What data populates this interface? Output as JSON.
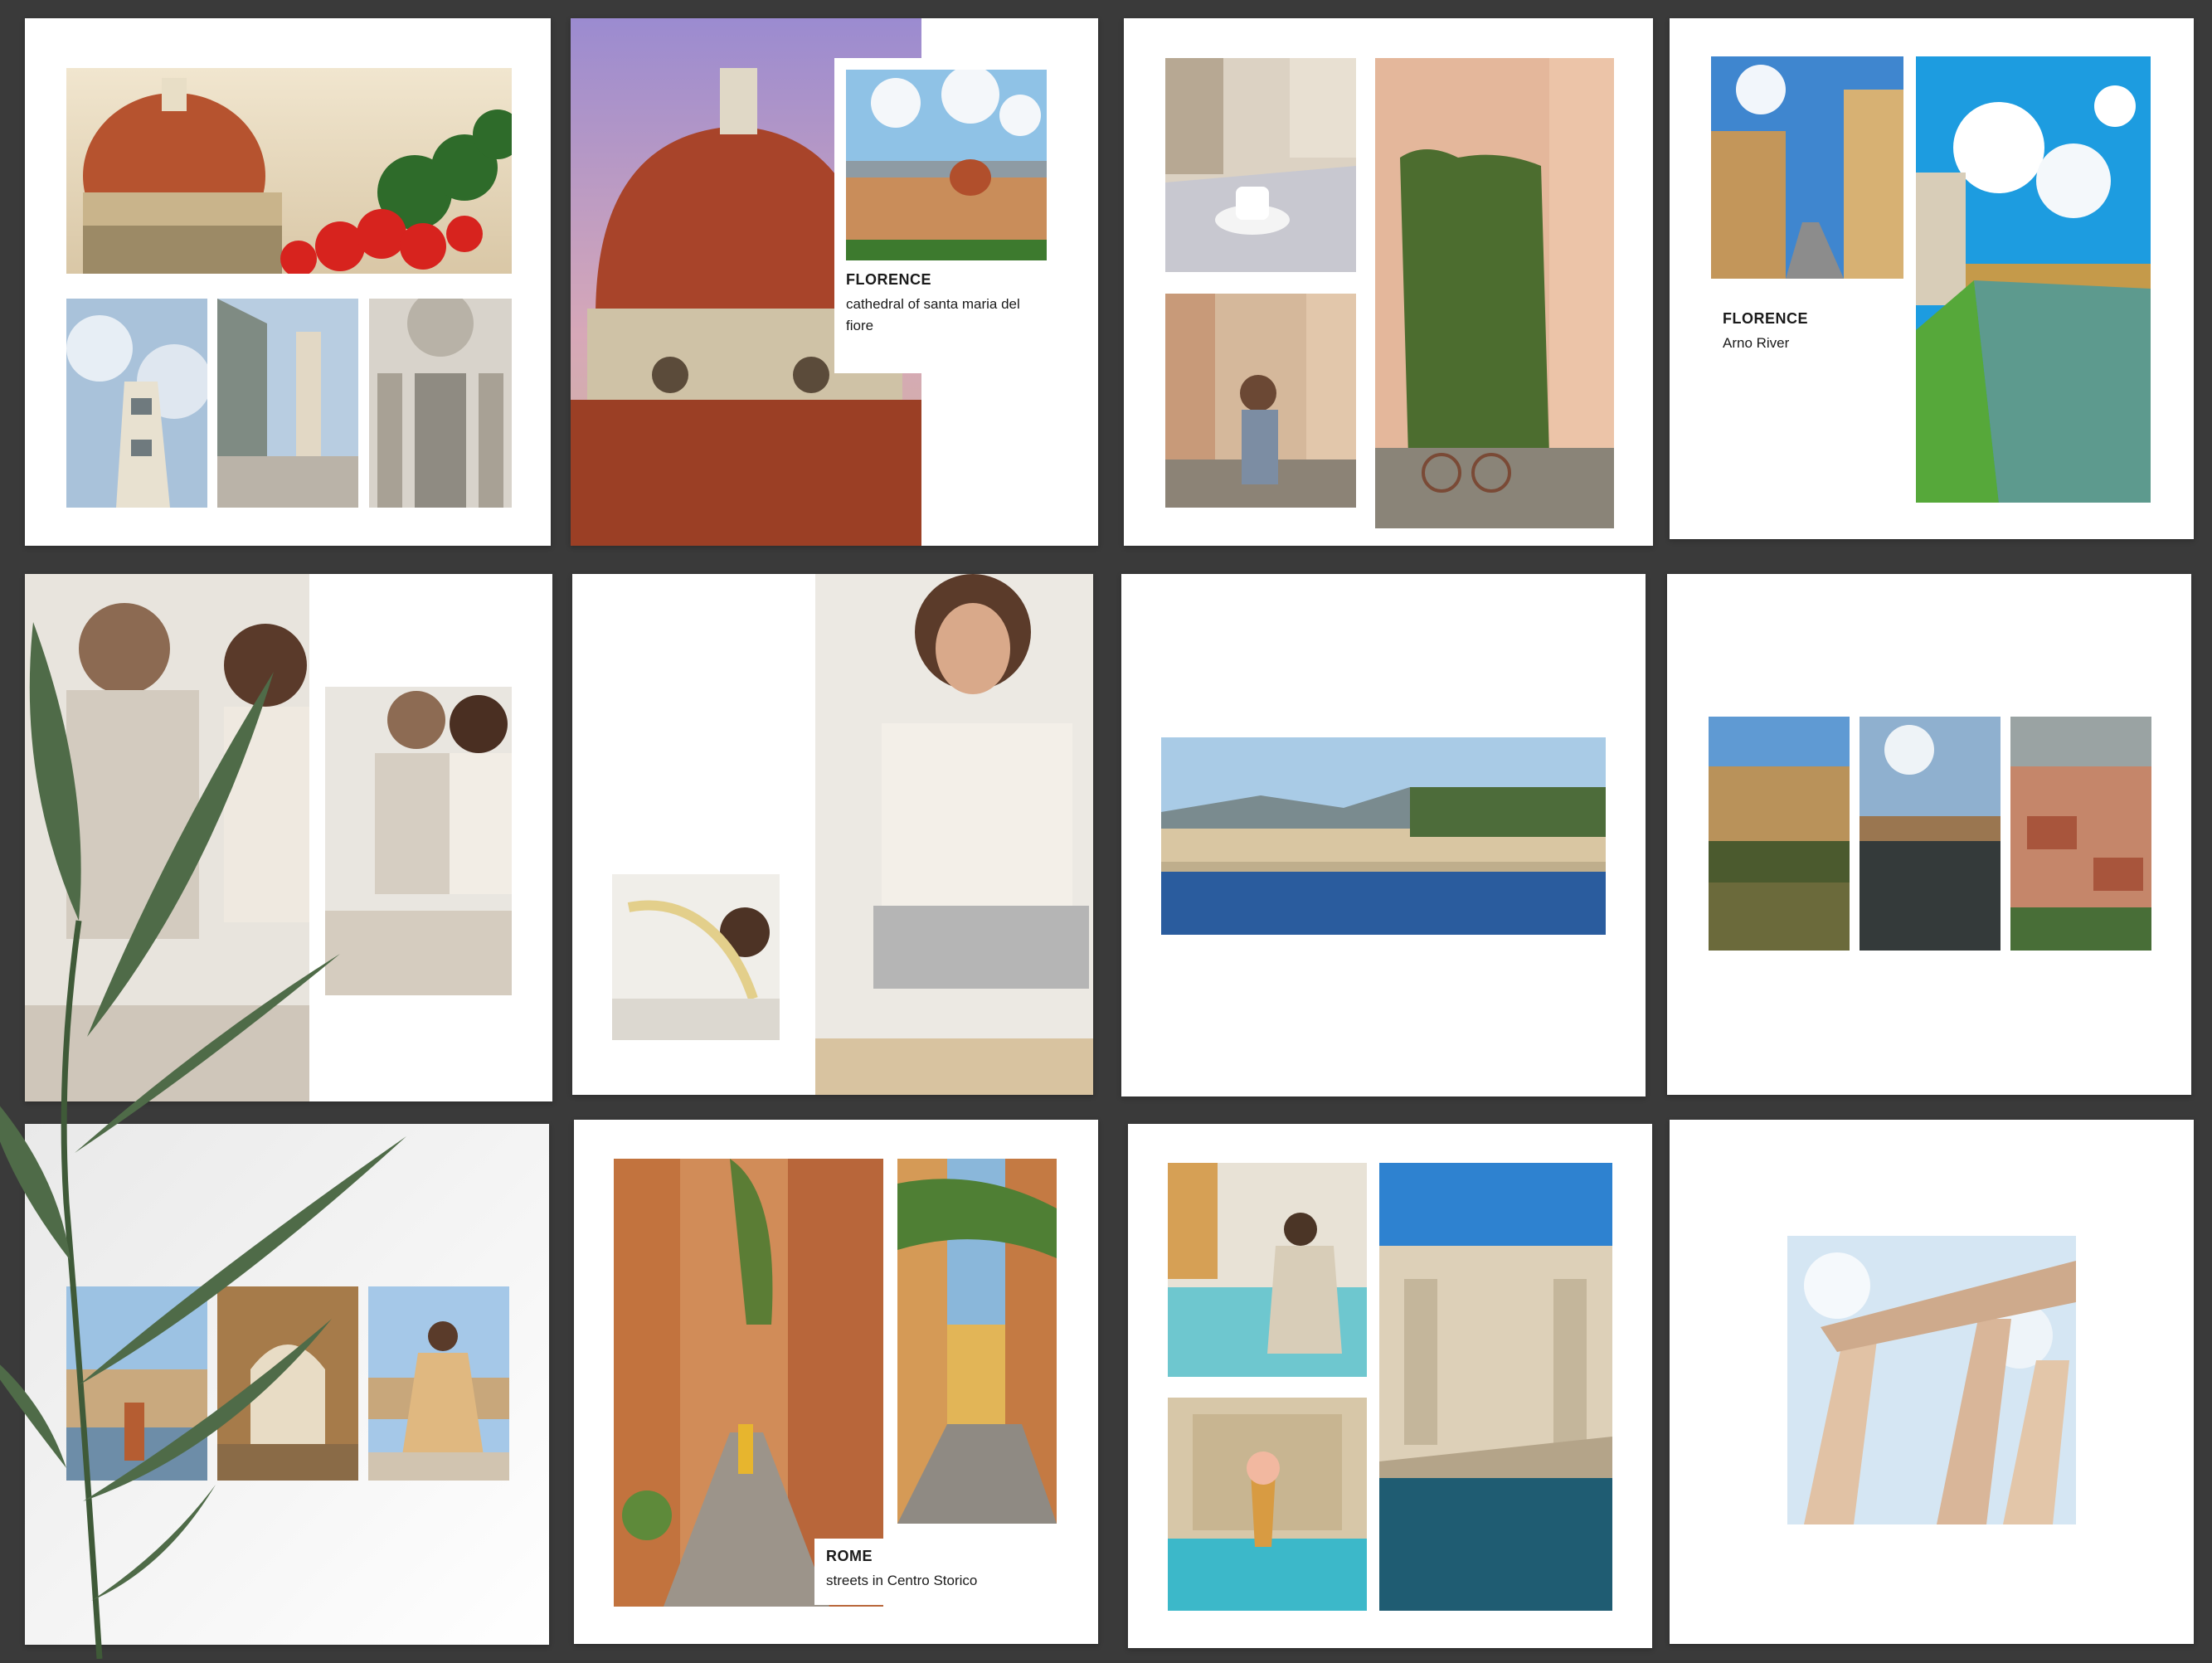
{
  "captions": {
    "florence_cathedral": {
      "title": "FLORENCE",
      "subtitle": "cathedral of santa maria del fiore"
    },
    "florence_arno": {
      "title": "FLORENCE",
      "subtitle": "Arno River"
    },
    "rome_streets": {
      "title": "ROME",
      "subtitle": "streets in Centro Storico"
    }
  },
  "colors": {
    "background": "#3a3a3a",
    "page": "#ffffff",
    "caption_text": "#1b1b1b",
    "leaf": "#4f6b48"
  },
  "photos": [
    "duomo-dome-with-red-flowers",
    "giotto-bell-tower",
    "cathedral-square",
    "cathedral-facade-detail",
    "duomo-dome-closeup-pink-sky",
    "florence-skyline-aerial",
    "cafe-cup-on-table",
    "girl-with-gelato-street",
    "ivy-covered-building-with-bicycle",
    "ponte-vecchio-street",
    "arno-river-ponte-vecchio",
    "couple-cooking",
    "couple-kneading-dough",
    "woman-making-pasta",
    "hands-pasta-noodles",
    "arno-river-bridge-panorama",
    "arno-reflection-1",
    "arno-reflection-2",
    "florence-rooftops",
    "plant-shadow-page",
    "riverside-woman-walking",
    "archway-walkway",
    "woman-sitting-riverside",
    "rome-ivy-street",
    "rome-yellow-street",
    "trevi-woman-sitting",
    "trevi-fountain",
    "trevi-gelato-hand",
    "greek-temple-columns"
  ]
}
